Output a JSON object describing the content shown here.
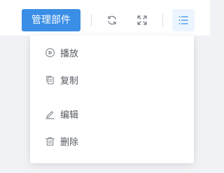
{
  "toolbar": {
    "manage_button_label": "管理部件",
    "refresh_icon": "refresh-icon",
    "fullscreen_icon": "fullscreen-icon",
    "menu_icon": "list-menu-icon"
  },
  "menu": {
    "items": [
      {
        "label": "播放",
        "icon": "play-circle-icon"
      },
      {
        "label": "复制",
        "icon": "copy-icon"
      },
      {
        "label": "编辑",
        "icon": "edit-icon"
      },
      {
        "label": "删除",
        "icon": "trash-icon"
      }
    ]
  },
  "colors": {
    "primary": "#3a8ee6",
    "icon_gray": "#7a7f88",
    "menu_active_icon": "#3a8ee6"
  }
}
